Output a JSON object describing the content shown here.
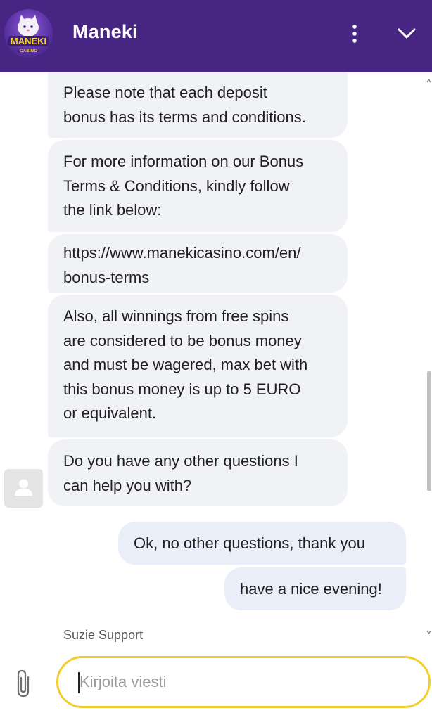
{
  "header": {
    "title": "Maneki",
    "logo_text": "MANEKI",
    "logo_subtext": "CASINO",
    "menu_icon": "more-vertical-icon",
    "collapse_icon": "chevron-down-icon",
    "background_color": "#472583"
  },
  "messages": {
    "incoming": [
      {
        "lines": [
          "Please note that each deposit",
          "bonus has its terms and conditions."
        ]
      },
      {
        "lines": [
          "For more information on our Bonus",
          "Terms & Conditions, kindly follow",
          "the link below:"
        ]
      },
      {
        "lines": [
          "https://www.manekicasino.com/en/",
          "bonus-terms"
        ]
      },
      {
        "lines": [
          "Also, all winnings from free spins",
          "are considered to be bonus money",
          "and must be wagered, max bet with",
          "this bonus money is up to 5 EURO",
          "or equivalent."
        ]
      },
      {
        "lines": [
          "Do you have any other questions I",
          "can help you with?"
        ]
      }
    ],
    "outgoing": [
      {
        "text": "Ok, no other questions, thank you"
      },
      {
        "text": "have a nice evening!"
      }
    ]
  },
  "agent": {
    "name": "Suzie Support",
    "avatar_icon": "user-avatar-icon"
  },
  "composer": {
    "placeholder": "Kirjoita viesti",
    "attach_icon": "paperclip-icon",
    "focus_color": "#f3cd2b"
  }
}
